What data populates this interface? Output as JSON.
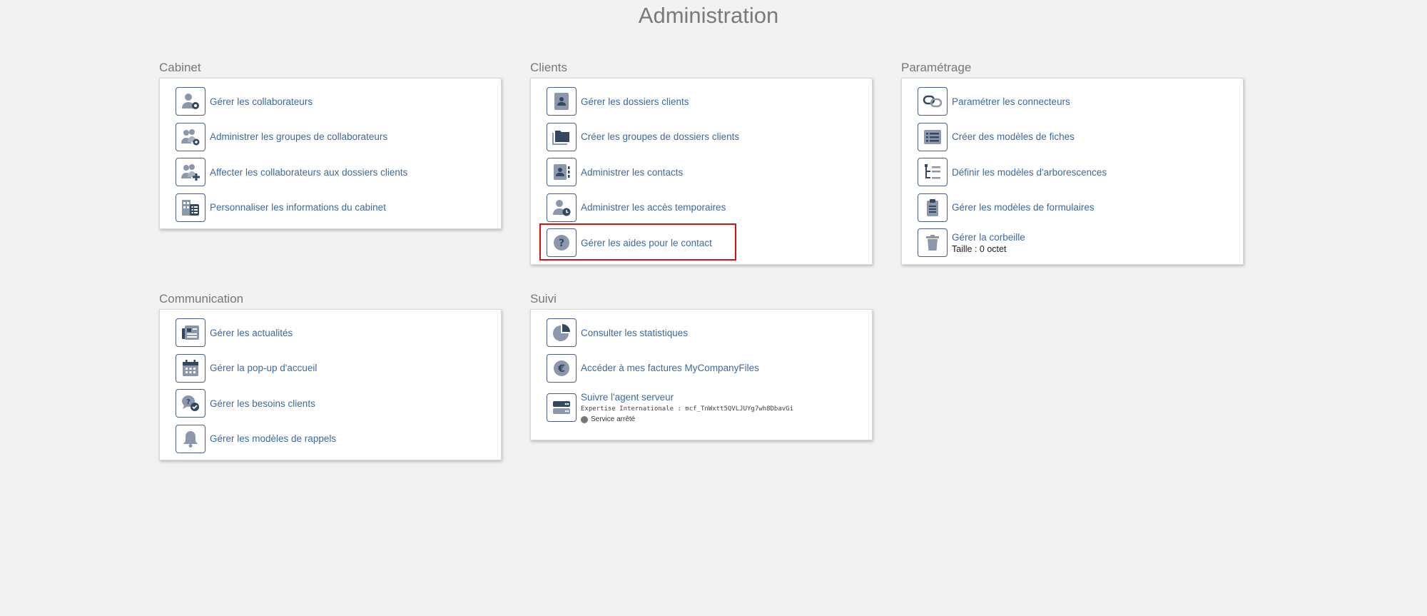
{
  "page": {
    "title": "Administration"
  },
  "cabinet": {
    "title": "Cabinet",
    "items": [
      {
        "label": "Gérer les collaborateurs",
        "icon": "user-gear-icon"
      },
      {
        "label": "Administrer les groupes de collaborateurs",
        "icon": "users-gear-icon"
      },
      {
        "label": "Affecter les collaborateurs aux dossiers clients",
        "icon": "users-plus-icon"
      },
      {
        "label": "Personnaliser les informations du cabinet",
        "icon": "building-list-icon"
      }
    ]
  },
  "clients": {
    "title": "Clients",
    "items": [
      {
        "label": "Gérer les dossiers clients",
        "icon": "client-folder-icon"
      },
      {
        "label": "Créer les groupes de dossiers clients",
        "icon": "folder-group-icon"
      },
      {
        "label": "Administrer les contacts",
        "icon": "contact-card-icon"
      },
      {
        "label": "Administrer les accès temporaires",
        "icon": "user-clock-icon"
      },
      {
        "label": "Gérer les aides pour le contact",
        "icon": "question-icon",
        "highlighted": true
      }
    ]
  },
  "parametrage": {
    "title": "Paramétrage",
    "items": [
      {
        "label": "Paramétrer les connecteurs",
        "icon": "link-icon"
      },
      {
        "label": "Créer des modèles de fiches",
        "icon": "list-form-icon"
      },
      {
        "label": "Définir les modèles d'arborescences",
        "icon": "tree-icon"
      },
      {
        "label": "Gérer les modèles de formulaires",
        "icon": "clipboard-icon"
      },
      {
        "label": "Gérer la corbeille",
        "icon": "trash-icon",
        "sub": "Taille : 0 octet"
      }
    ]
  },
  "communication": {
    "title": "Communication",
    "items": [
      {
        "label": "Gérer les actualités",
        "icon": "newspaper-icon"
      },
      {
        "label": "Gérer la pop-up d'accueil",
        "icon": "calendar-icon"
      },
      {
        "label": "Gérer les besoins clients",
        "icon": "chat-check-icon"
      },
      {
        "label": "Gérer les modèles de rappels",
        "icon": "bell-icon"
      }
    ]
  },
  "suivi": {
    "title": "Suivi",
    "items": [
      {
        "label": "Consulter les statistiques",
        "icon": "pie-chart-icon"
      },
      {
        "label": "Accéder à mes factures MyCompanyFiles",
        "icon": "euro-icon"
      },
      {
        "label": "Suivre l'agent serveur",
        "icon": "server-icon",
        "detail": "Expertise Internationale : mcf_TnWxtt5QVLJUYg7wh8DbavGi",
        "status": "Service arrêté"
      }
    ]
  },
  "colors": {
    "link": "#3d6a9e",
    "icon": "#4a5f7f",
    "highlight": "#d11111"
  }
}
